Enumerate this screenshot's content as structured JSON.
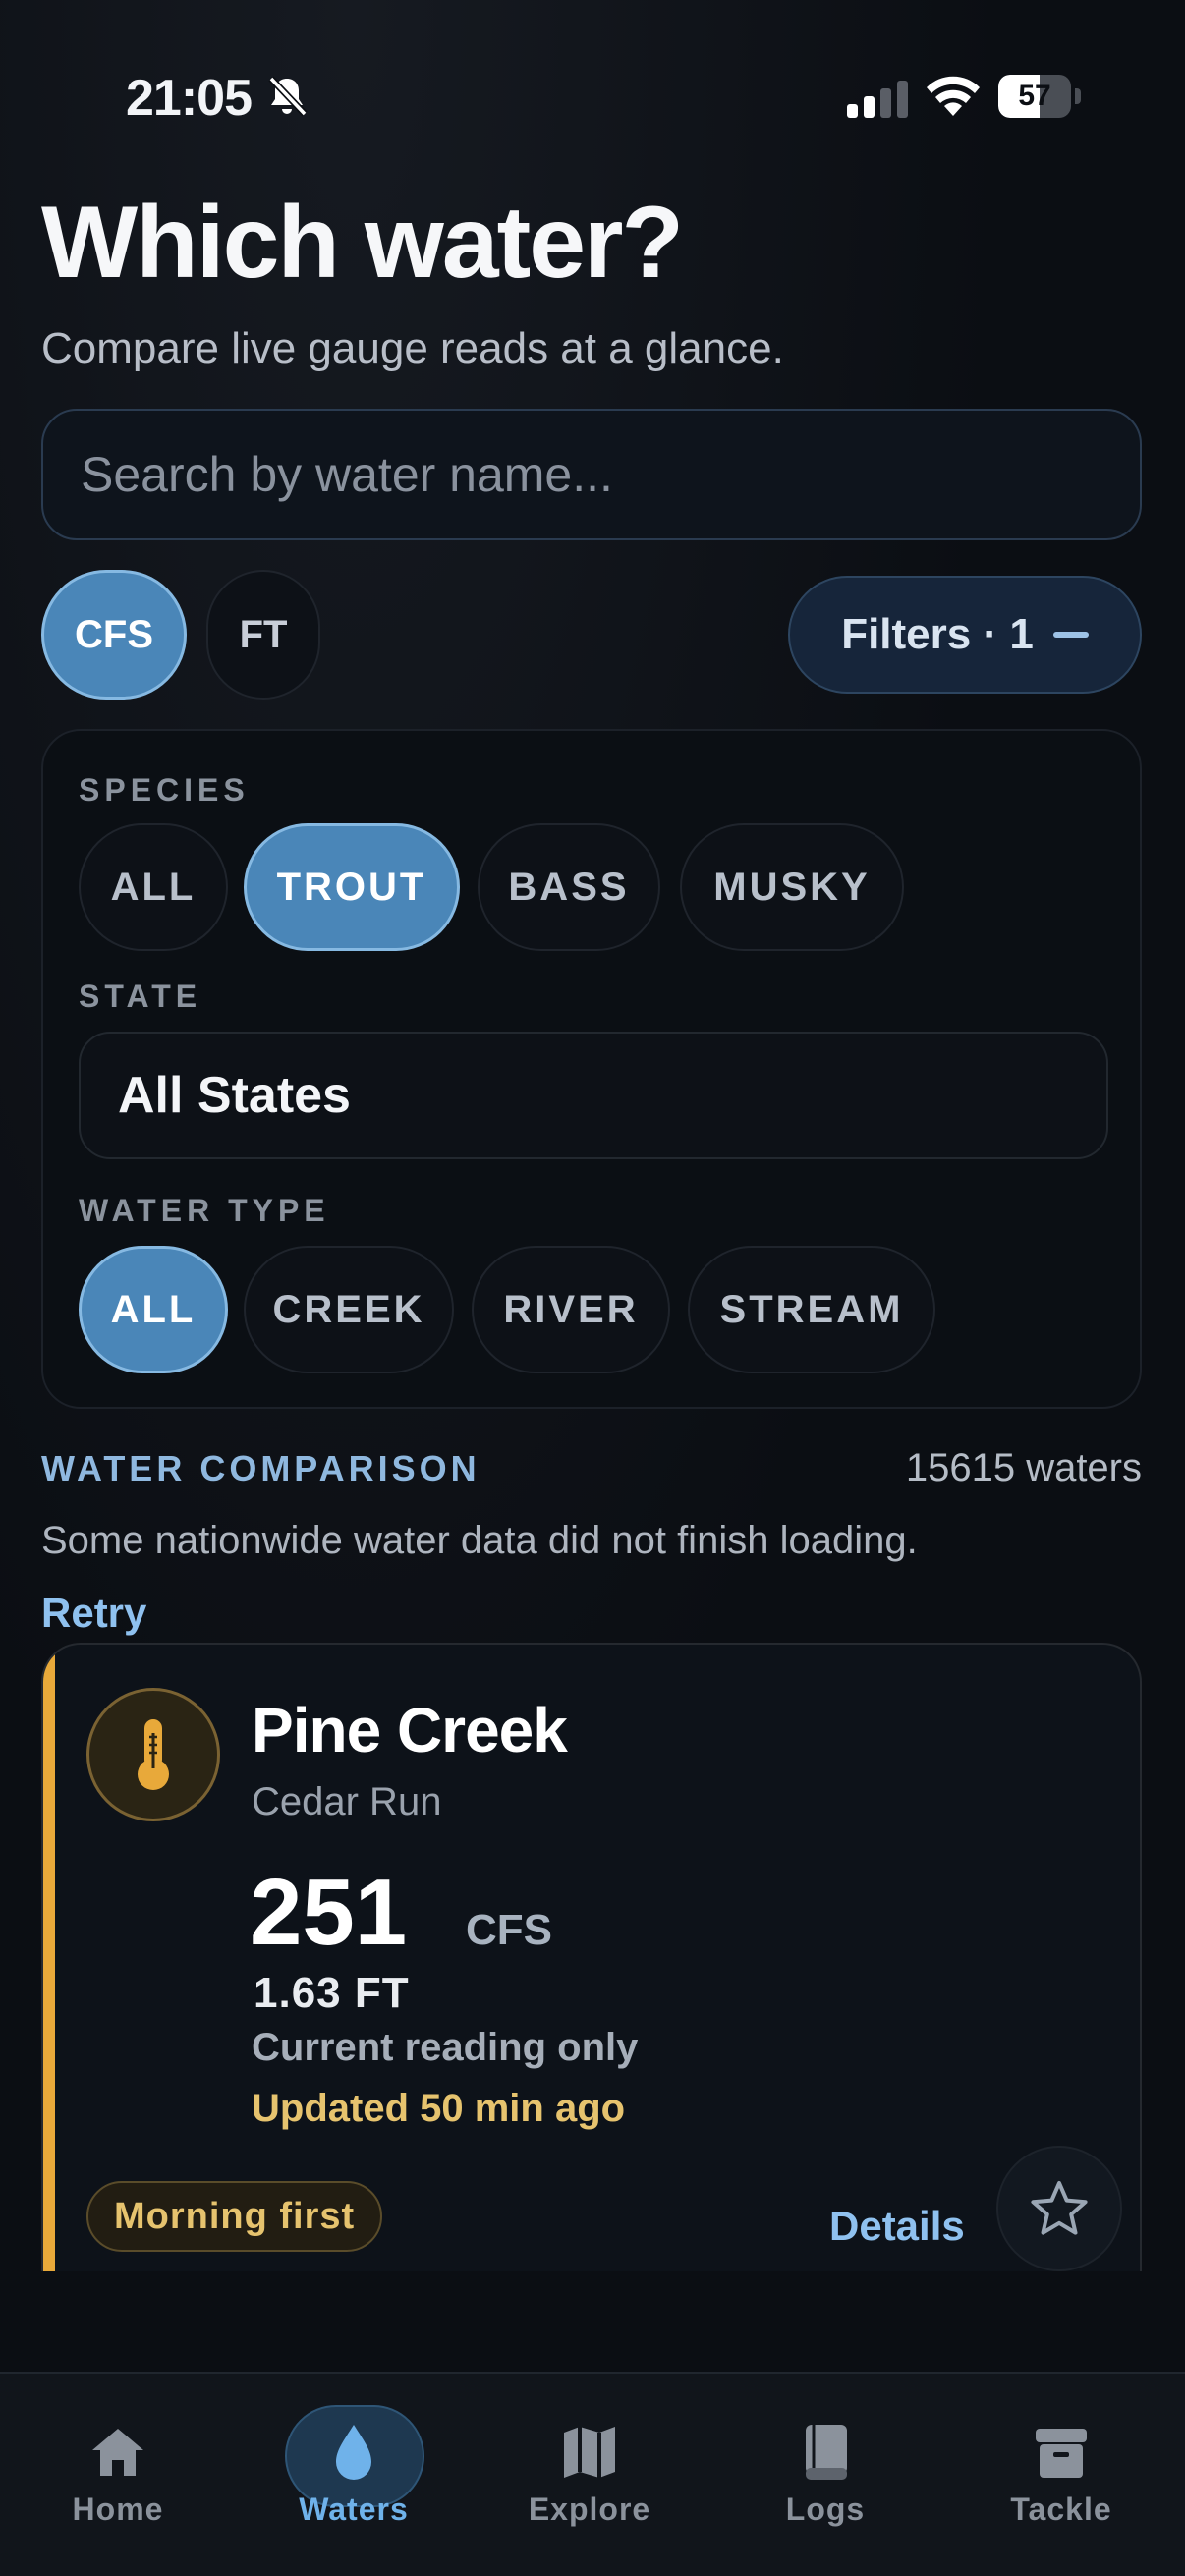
{
  "status": {
    "time": "21:05",
    "battery": "57",
    "battery_level": 0.57
  },
  "header": {
    "title": "Which water?",
    "subtitle": "Compare live gauge reads at a glance."
  },
  "search": {
    "placeholder": "Search by water name...",
    "value": ""
  },
  "units": {
    "cfs": "CFS",
    "ft": "FT",
    "selected": "CFS"
  },
  "filters": {
    "button_label": "Filters · 1",
    "species": {
      "label": "SPECIES",
      "options": [
        "ALL",
        "TROUT",
        "BASS",
        "MUSKY"
      ],
      "selected": "TROUT"
    },
    "state": {
      "label": "STATE",
      "value": "All States"
    },
    "water_type": {
      "label": "WATER TYPE",
      "options": [
        "ALL",
        "CREEK",
        "RIVER",
        "STREAM"
      ],
      "selected": "ALL"
    }
  },
  "comparison": {
    "label": "WATER COMPARISON",
    "count": "15615 waters",
    "error": "Some nationwide water data did not finish loading.",
    "retry": "Retry"
  },
  "card": {
    "name": "Pine Creek",
    "location": "Cedar Run",
    "value": "251",
    "unit": "CFS",
    "height": "1.63 FT",
    "note": "Current reading only",
    "updated": "Updated 50 min ago",
    "badge": "Morning first",
    "details": "Details",
    "accent_color": "#e8a93a",
    "icon": "thermometer-icon"
  },
  "tabs": [
    {
      "label": "Home",
      "icon": "home-icon"
    },
    {
      "label": "Waters",
      "icon": "water-drop-icon",
      "active": true
    },
    {
      "label": "Explore",
      "icon": "map-icon"
    },
    {
      "label": "Logs",
      "icon": "book-icon"
    },
    {
      "label": "Tackle",
      "icon": "tackle-box-icon"
    }
  ]
}
